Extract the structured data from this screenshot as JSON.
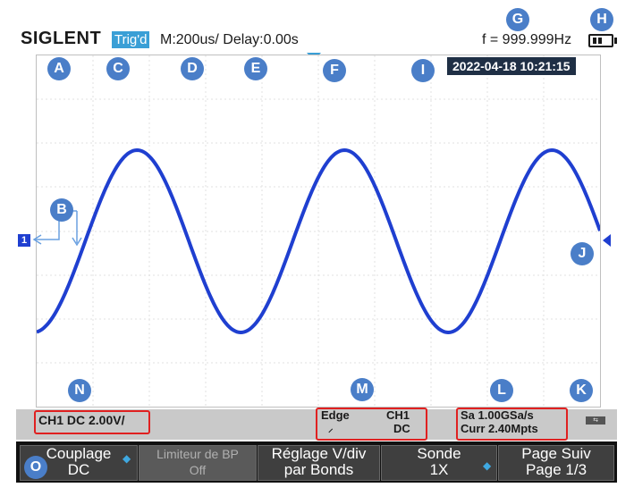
{
  "header": {
    "brand": "SIGLENT",
    "trigger_status": "Trig'd",
    "timebase": "M:200us/ Delay:0.00s",
    "frequency": "f = 999.999Hz",
    "battery_icon": "battery-icon"
  },
  "display": {
    "datetime": "2022-04-18 10:21:15",
    "channel_marker": "1",
    "trace_color": "#1f3fd0",
    "waveform": {
      "type": "sine",
      "frequency_hz": 999.999,
      "timebase_per_div": "200us"
    }
  },
  "labels": {
    "A": "A",
    "B": "B",
    "C": "C",
    "D": "D",
    "E": "E",
    "F": "F",
    "G": "G",
    "H": "H",
    "I": "I",
    "J": "J",
    "K": "K",
    "L": "L",
    "M": "M",
    "N": "N",
    "O": "O"
  },
  "status": {
    "channel": "CH1 DC 2.00V/",
    "trigger_type": "Edge",
    "trigger_slope": "⸝",
    "trigger_source": "CH1",
    "trigger_coupling": "DC",
    "sample_rate": "Sa 1.00GSa/s",
    "memory_depth": "Curr 2.40Mpts",
    "usb_icon": "usb-icon"
  },
  "menu": [
    {
      "line1": "Couplage",
      "line2": "DC"
    },
    {
      "line1": "Limiteur de BP",
      "line2": "Off"
    },
    {
      "line1": "Réglage V/div",
      "line2": "par Bonds"
    },
    {
      "line1": "Sonde",
      "line2": "1X"
    },
    {
      "line1": "Page Suiv",
      "line2": "Page 1/3"
    }
  ]
}
